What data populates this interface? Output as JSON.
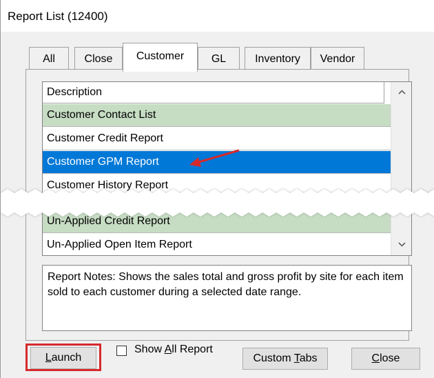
{
  "window": {
    "title": "Report List (12400)"
  },
  "tabs": [
    {
      "label": "All",
      "active": false
    },
    {
      "label": "Close",
      "active": false
    },
    {
      "label": "Customer",
      "active": true
    },
    {
      "label": "GL",
      "active": false
    },
    {
      "label": "Inventory",
      "active": false
    },
    {
      "label": "Vendor",
      "active": false
    }
  ],
  "report_list": {
    "column_header": "Description",
    "rows": [
      {
        "label": "Customer Contact List",
        "state": "alternate"
      },
      {
        "label": "Customer Credit Report",
        "state": "normal"
      },
      {
        "label": "Customer GPM Report",
        "state": "selected"
      },
      {
        "label": "Customer History Report",
        "state": "normal"
      },
      {
        "label": "Un-Applied Credit Report",
        "state": "alternate"
      },
      {
        "label": "Un-Applied Open Item Report",
        "state": "normal"
      }
    ]
  },
  "notes": {
    "text": "Report Notes:  Shows the sales total and gross profit by site for each item sold to each customer during a selected date range."
  },
  "buttons": {
    "launch": {
      "prefix": "",
      "mnemonic": "L",
      "suffix": "aunch"
    },
    "show_all_report": {
      "prefix": "Show ",
      "mnemonic": "A",
      "suffix": "ll Report",
      "checked": false
    },
    "custom_tabs": {
      "prefix": "Custom ",
      "mnemonic": "T",
      "suffix": "abs"
    },
    "close": {
      "prefix": "",
      "mnemonic": "C",
      "suffix": "lose"
    }
  },
  "colors": {
    "selected_row": "#0078d7",
    "alternate_row": "#c6dcc3",
    "highlight_box": "#d6292c",
    "annotation_arrow": "#d6292c"
  },
  "icons": {
    "scroll_up": "chevron-up-icon",
    "scroll_down": "chevron-down-icon",
    "annotation": "red-arrow-icon"
  }
}
